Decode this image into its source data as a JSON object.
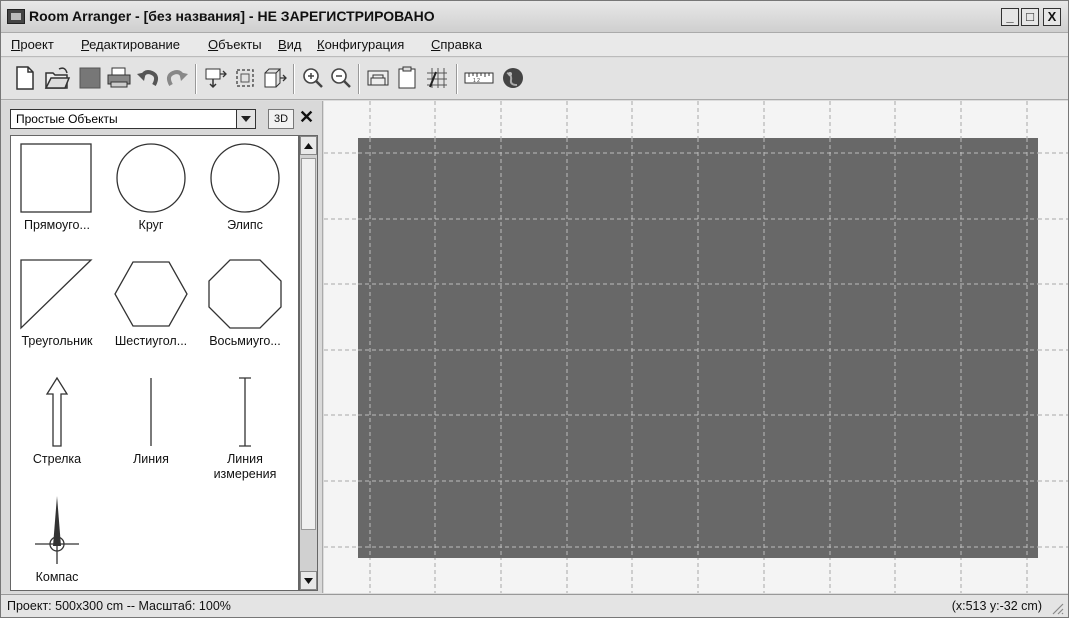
{
  "window": {
    "title": "Room Arranger - [без названия] - НЕ ЗАРЕГИСТРИРОВАНО",
    "minimize_glyph": "_",
    "maximize_glyph": "□",
    "close_glyph": "X"
  },
  "menu": [
    {
      "key": "П",
      "rest": "роект"
    },
    {
      "key": "Р",
      "rest": "едактирование"
    },
    {
      "key": "О",
      "rest": "бъекты"
    },
    {
      "key": "В",
      "rest": "ид"
    },
    {
      "key": "К",
      "rest": "онфигурация"
    },
    {
      "key": "С",
      "rest": "правка"
    }
  ],
  "toolbar": {
    "icons": [
      "new-document-icon",
      "open-folder-icon",
      "save-icon",
      "print-icon",
      "undo-icon",
      "redo-icon",
      "move-down-icon",
      "select-area-icon",
      "object-export-icon",
      "zoom-in-icon",
      "zoom-out-icon",
      "furniture-view-icon",
      "clipboard-icon",
      "grid-select-icon",
      "ruler-icon",
      "globe-icon"
    ]
  },
  "panel": {
    "category": "Простые Объекты",
    "btn_3d": "3D",
    "close": "✕",
    "shapes": [
      {
        "id": "rectangle",
        "label": "Прямоуго..."
      },
      {
        "id": "circle",
        "label": "Круг"
      },
      {
        "id": "ellipse",
        "label": "Элипс"
      },
      {
        "id": "triangle",
        "label": "Треугольник"
      },
      {
        "id": "hexagon",
        "label": "Шестиугол..."
      },
      {
        "id": "octagon",
        "label": "Восьмиуго..."
      },
      {
        "id": "arrow",
        "label": "Стрелка"
      },
      {
        "id": "line",
        "label": "Линия"
      },
      {
        "id": "measure-line",
        "label": "Линия измерения"
      },
      {
        "id": "compass",
        "label": "Компас"
      }
    ]
  },
  "colors": {
    "room_fill": "#686868",
    "grid_line": "#bdbdbd"
  },
  "status": {
    "left": "Проект: 500x300 cm -- Масштаб: 100%",
    "right": "(x:513 y:-32 cm)"
  }
}
